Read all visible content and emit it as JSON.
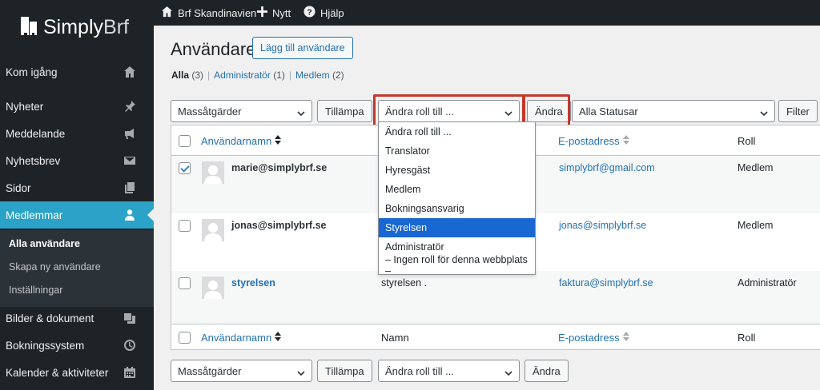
{
  "topbar": {
    "site_name": "Brf Skandinavien",
    "new_label": "Nytt",
    "help_label": "Hjälp"
  },
  "logo": {
    "text_a": "Simply",
    "text_b": "Brf"
  },
  "sidebar": {
    "items": [
      {
        "label": "Kom igång",
        "icon": "home-icon"
      },
      {
        "label": "Nyheter",
        "icon": "pin-icon"
      },
      {
        "label": "Meddelande",
        "icon": "megaphone-icon"
      },
      {
        "label": "Nyhetsbrev",
        "icon": "envelope-icon"
      },
      {
        "label": "Sidor",
        "icon": "pages-icon"
      },
      {
        "label": "Medlemmar",
        "icon": "user-icon"
      },
      {
        "label": "Bilder & dokument",
        "icon": "media-icon"
      },
      {
        "label": "Bokningssystem",
        "icon": "clock-icon"
      },
      {
        "label": "Kalender & aktiviteter",
        "icon": "calendar-icon"
      }
    ],
    "submenu": [
      "Alla användare",
      "Skapa ny användare",
      "Inställningar"
    ]
  },
  "page": {
    "title": "Användare",
    "add_button": "Lägg till användare",
    "filters": {
      "all": "Alla",
      "all_count": "(3)",
      "admin": "Administratör",
      "admin_count": "(1)",
      "member": "Medlem",
      "member_count": "(2)",
      "sep": "|"
    }
  },
  "toolbar": {
    "bulk_actions": "Massåtgärder",
    "apply": "Tillämpa",
    "change_role": "Ändra roll till ...",
    "change": "Ändra",
    "status": "Alla Statusar",
    "filter": "Filter"
  },
  "table": {
    "columns": {
      "username": "Användarnamn",
      "name": "Namn",
      "email": "E-postadress",
      "role": "Roll"
    },
    "rows": [
      {
        "username": "marie@simplybrf.se",
        "name": "",
        "email": "simplybrf@gmail.com",
        "role": "Medlem",
        "checked": true
      },
      {
        "username": "jonas@simplybrf.se",
        "name": "",
        "email": "jonas@simplybrf.se",
        "role": "Medlem",
        "checked": false
      },
      {
        "username": "styrelsen",
        "name": "styrelsen .",
        "email": "faktura@simplybrf.se",
        "role": "Administratör",
        "checked": false
      }
    ]
  },
  "dropdown": {
    "options": [
      "Ändra roll till ...",
      "Translator",
      "Hyresgäst",
      "Medlem",
      "Bokningsansvarig",
      "Styrelsen",
      "Administratör",
      "– Ingen roll för denna webbplats –"
    ],
    "selected_index": 5
  },
  "colors": {
    "accent": "#2ba2c8",
    "link": "#2271b1",
    "highlight": "#c4372a",
    "selected_option": "#1967d2"
  }
}
